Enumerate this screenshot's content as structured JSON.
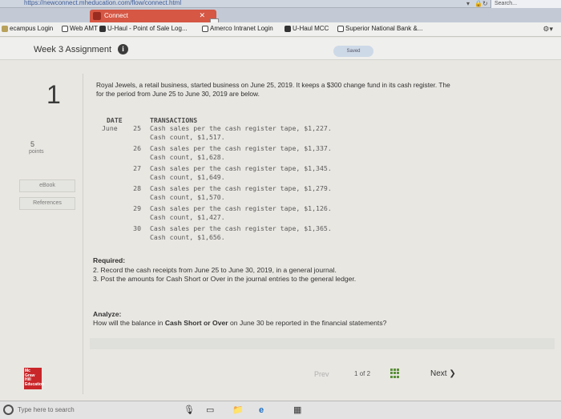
{
  "browser": {
    "url": "https://newconnect.mheducation.com/flow/connect.html",
    "search_placeholder": "Search...",
    "tab_title": "Connect",
    "favorites": [
      "ecampus Login",
      "Web AMT",
      "U-Haul - Point of Sale Log...",
      "Amerco Intranet Login",
      "U-Haul MCC",
      "Superior National Bank &..."
    ]
  },
  "header": {
    "title": "Week 3 Assignment",
    "saved": "Saved"
  },
  "sidebar": {
    "question_number": "1",
    "points_value": "5",
    "points_label": "points",
    "ebook": "eBook",
    "references": "References"
  },
  "question": {
    "intro_line1": "Royal Jewels, a retail business, started business on June 25, 2019. It keeps a $300 change fund in its cash register. The",
    "intro_line2": "for the period from June 25 to June 30, 2019 are below.",
    "col_date": "DATE",
    "col_transactions": "TRANSACTIONS",
    "month": "June",
    "transactions": [
      {
        "day": "25",
        "sales": "Cash sales per the cash register tape, $1,227.",
        "count": "Cash count, $1,517."
      },
      {
        "day": "26",
        "sales": "Cash sales per the cash register tape, $1,337.",
        "count": "Cash count, $1,628."
      },
      {
        "day": "27",
        "sales": "Cash sales per the cash register tape, $1,345.",
        "count": "Cash count, $1,649."
      },
      {
        "day": "28",
        "sales": "Cash sales per the cash register tape, $1,279.",
        "count": "Cash count, $1,570."
      },
      {
        "day": "29",
        "sales": "Cash sales per the cash register tape, $1,126.",
        "count": "Cash count, $1,427."
      },
      {
        "day": "30",
        "sales": "Cash sales per the cash register tape, $1,365.",
        "count": "Cash count, $1,656."
      }
    ],
    "required_label": "Required:",
    "required_1": "2. Record the cash receipts from June 25 to June 30, 2019, in a general journal.",
    "required_2": "3. Post the amounts for Cash Short or Over in the journal entries to the general ledger.",
    "analyze_label": "Analyze:",
    "analyze_pre": "How will the balance in ",
    "analyze_bold": "Cash Short or Over",
    "analyze_post": " on June 30 be reported in the financial statements?"
  },
  "footer": {
    "logo_text": "Mc Graw Hill Education",
    "prev": "Prev",
    "page_current": "1",
    "page_of": "of",
    "page_total": "2",
    "next": "Next"
  },
  "taskbar": {
    "search_placeholder": "Type here to search"
  },
  "colors": {
    "tab_accent": "#d55744",
    "logo_red": "#c9262a",
    "grid_green": "#5b8f3a"
  }
}
